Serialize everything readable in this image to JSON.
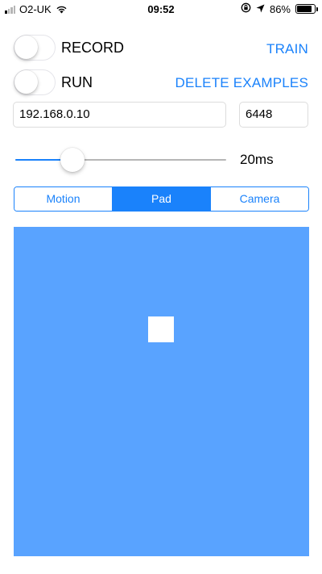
{
  "status_bar": {
    "carrier": "O2-UK",
    "time": "09:52",
    "battery_percent": "86%",
    "battery_level": 0.86,
    "signal_bars": 4,
    "signal_bars_active": 1,
    "icons": [
      "signal-icon",
      "wifi-icon",
      "orientation-lock-icon",
      "location-icon",
      "battery-icon"
    ]
  },
  "controls": {
    "record": {
      "label": "RECORD",
      "on": false
    },
    "run": {
      "label": "RUN",
      "on": false
    },
    "train_label": "TRAIN",
    "delete_label": "DELETE EXAMPLES"
  },
  "connection": {
    "host": "192.168.0.10",
    "port": "6448"
  },
  "interval": {
    "value_label": "20ms",
    "fraction": 0.27
  },
  "modes": {
    "options": [
      "Motion",
      "Pad",
      "Camera"
    ],
    "selected": "Pad"
  },
  "colors": {
    "accent": "#1a82fb",
    "pad_background": "#59a3ff",
    "pad_marker": "#ffffff"
  }
}
